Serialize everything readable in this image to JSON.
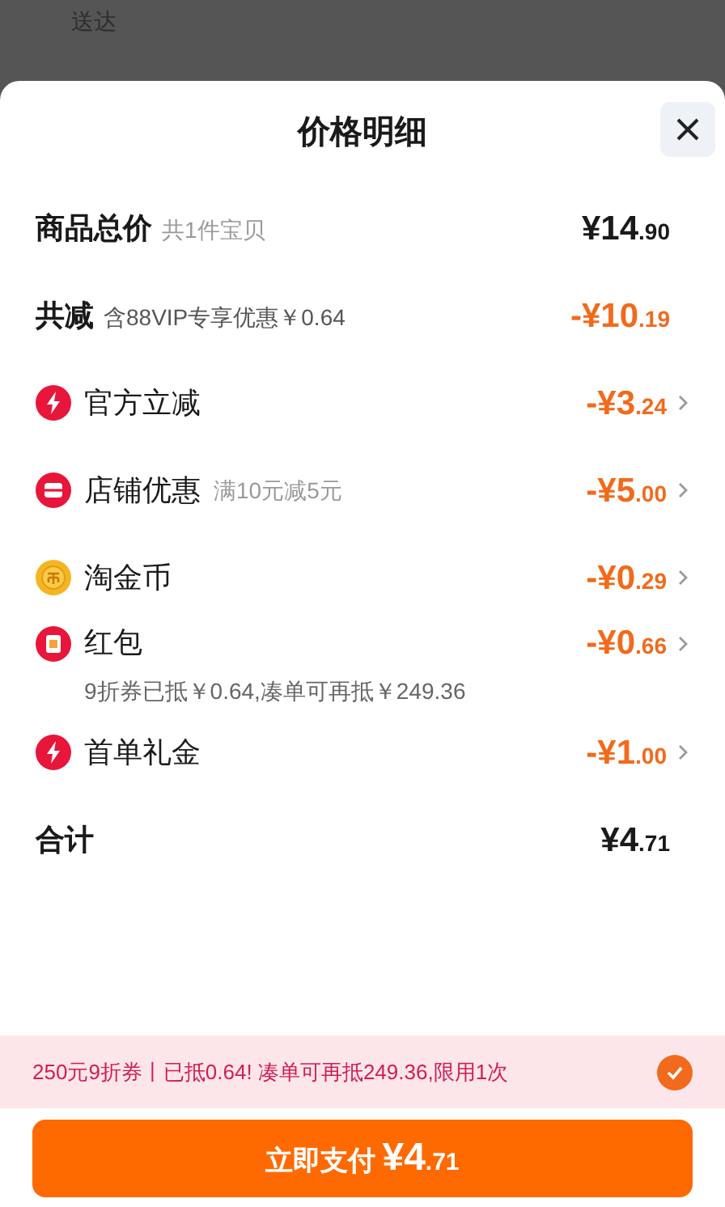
{
  "background": {
    "text": "送达"
  },
  "sheet": {
    "title": "价格明细"
  },
  "summary": [
    {
      "label": "商品总价",
      "note": "共1件宝贝",
      "amount": "¥14",
      "cents": ".90",
      "kind": "normal"
    },
    {
      "label": "共减",
      "note": "含88VIP专享优惠￥0.64",
      "amount": "-¥10",
      "cents": ".19",
      "kind": "discount"
    }
  ],
  "discounts": [
    {
      "kind": "bolt",
      "label": "官方立减",
      "amount": "-¥3",
      "cents": ".24"
    },
    {
      "kind": "shop",
      "label": "店铺优惠",
      "note": "满10元减5元",
      "amount": "-¥5",
      "cents": ".00"
    },
    {
      "kind": "coin",
      "label": "淘金币",
      "amount": "-¥0",
      "cents": ".29"
    },
    {
      "kind": "redpacket",
      "label": "红包",
      "amount": "-¥0",
      "cents": ".66",
      "detail": "9折券已抵￥0.64,凑单可再抵￥249.36"
    },
    {
      "kind": "bolt",
      "label": "首单礼金",
      "amount": "-¥1",
      "cents": ".00"
    }
  ],
  "total": {
    "label": "合计",
    "amount": "¥4",
    "cents": ".71"
  },
  "coupon_banner": {
    "text": "250元9折券丨已抵0.64! 凑单可再抵249.36,限用1次",
    "checked": true
  },
  "pay_button": {
    "label": "立即支付",
    "amount": "¥4",
    "cents": ".71"
  }
}
